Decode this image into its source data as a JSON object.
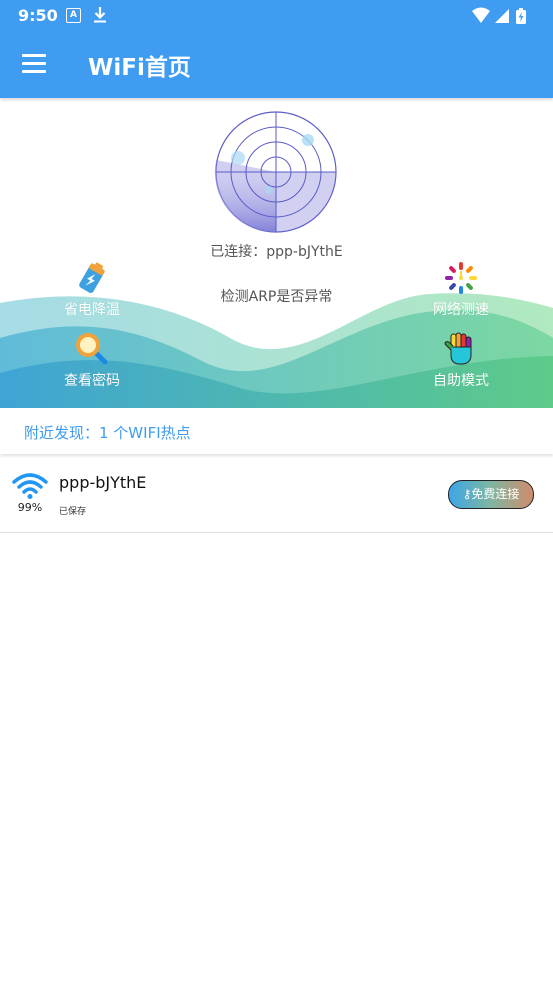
{
  "status_bar": {
    "time": "9:50",
    "a_badge": "A",
    "icons": [
      "a-badge-icon",
      "download-icon",
      "wifi-icon",
      "cellular-signal-icon",
      "battery-charging-icon"
    ]
  },
  "app_bar": {
    "title": "WiFi首页",
    "menu_icon": "hamburger-menu-icon",
    "color": "#3f9cf0"
  },
  "hero": {
    "connected_text": "已连接：ppp-bJYthE",
    "arp_text": "检测ARP是否异常",
    "features": [
      {
        "label": "省电降温",
        "icon": "battery-icon"
      },
      {
        "label": "网络测速",
        "icon": "speedometer-icon"
      },
      {
        "label": "查看密码",
        "icon": "magnifier-icon"
      },
      {
        "label": "自助模式",
        "icon": "hand-icon"
      }
    ]
  },
  "nearby": {
    "text": "附近发现：1 个WIFI热点"
  },
  "wifi_list": [
    {
      "ssid": "ppp-bJYthE",
      "signal_pct": "99%",
      "status": "已保存",
      "button_label": "⚷免费连接",
      "signal_icon": "wifi-signal-icon"
    }
  ]
}
